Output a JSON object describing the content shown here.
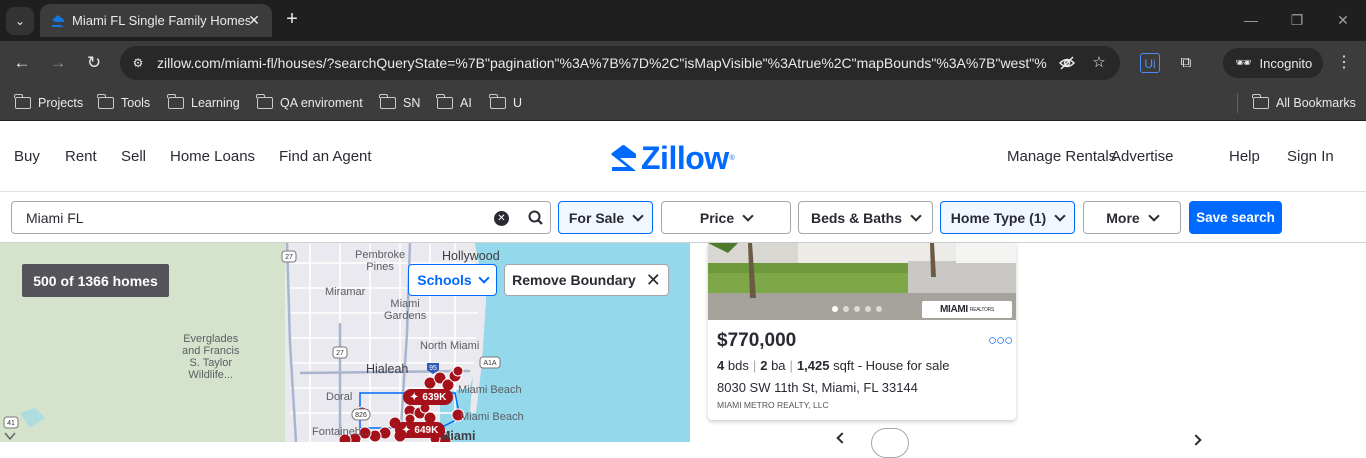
{
  "browser": {
    "tab_title": "Miami FL Single Family Homes F",
    "url": "zillow.com/miami-fl/houses/?searchQueryState=%7B\"pagination\"%3A%7B%7D%2C\"isMapVisible\"%3Atrue%2C\"mapBounds\"%3A%7B\"west\"%...",
    "incognito_label": "Incognito",
    "bookmarks": [
      "Projects",
      "Tools",
      "Learning",
      "QA enviroment",
      "SN",
      "AI",
      "U"
    ],
    "all_bookmarks": "All Bookmarks"
  },
  "nav": {
    "left": [
      "Buy",
      "Rent",
      "Sell",
      "Home Loans",
      "Find an Agent"
    ],
    "logo": "Zillow",
    "right": [
      "Manage Rentals",
      "Advertise",
      "Help",
      "Sign In"
    ]
  },
  "filters": {
    "search_value": "Miami FL",
    "for_sale": "For Sale",
    "price": "Price",
    "beds_baths": "Beds & Baths",
    "home_type": "Home Type (1)",
    "more": "More",
    "save_search": "Save search"
  },
  "map": {
    "count": "500 of 1366 homes",
    "schools": "Schools",
    "remove_boundary": "Remove Boundary",
    "labels": {
      "hollywood": "Hollywood",
      "pembroke": "Pembroke\nPines",
      "miramar": "Miramar",
      "miami_gardens": "Miami\nGardens",
      "everglades": "Everglades\nand Francis\nS. Taylor\nWildlife...",
      "north_miami": "North Miami",
      "hialeah": "Hialeah",
      "miami_beach": "Miami Beach",
      "miami_beach2": "Miami Beach",
      "doral": "Doral",
      "fontainebleau": "Fontaineb...",
      "miami": "Miami"
    },
    "shields": [
      "27",
      "27",
      "95",
      "A1A",
      "826",
      "41"
    ],
    "pins": [
      "639K",
      "649K"
    ]
  },
  "listing": {
    "price": "$770,000",
    "beds": "4",
    "beds_unit": "bds",
    "baths": "2",
    "baths_unit": "ba",
    "sqft": "1,425",
    "sqft_unit": "sqft",
    "type": "- House for sale",
    "address": "8030 SW 11th St, Miami, FL 33144",
    "broker": "MIAMI METRO REALTY, LLC",
    "brokerage_logo": "MIAMI",
    "brokerage_logo_small": "REALTORS"
  },
  "colors": {
    "brand": "#006aff",
    "pin": "#a5111a",
    "chrome_dark": "#1f1f1f",
    "chrome": "#3c3c3c"
  }
}
